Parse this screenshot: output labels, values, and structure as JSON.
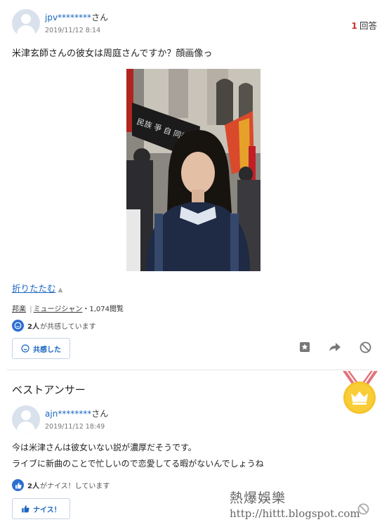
{
  "question": {
    "user": "jpv********",
    "honorific": "さん",
    "date": "2019/11/12 8:14",
    "answer_count": "1",
    "answer_count_label": "回答",
    "text": "米津玄師さんの彼女は周庭さんですか？顔画像っ",
    "collapse_label": "折りたたむ",
    "category_1": "邦楽",
    "category_sep": "|",
    "category_2": "ミュージシャン",
    "views": "・1,074閲覧",
    "empathy_count": "2人",
    "empathy_text": "が共感しています",
    "empathy_button": "共感した"
  },
  "best_answer": {
    "section_title": "ベストアンサー",
    "user": "ajn********",
    "honorific": "さん",
    "date": "2019/11/12 18:49",
    "text_line_1": "今は米津さんは彼女いない説が濃厚だそうです。",
    "text_line_2": "ライブに新曲のことで忙しいので恋愛してる暇がないんでしょうね",
    "nice_count": "2人",
    "nice_text": "がナイス！しています",
    "nice_button": "ナイス！"
  },
  "watermark": {
    "line_1": "熱爆娛樂",
    "line_2": "http://hittt.blogspot.com"
  },
  "colors": {
    "link": "#1a66c2",
    "count_red": "#c8382b",
    "medal_gold": "#f6c42a",
    "ribbon": "#e3737a"
  },
  "icons": [
    "user-avatar-icon",
    "empathy-icon",
    "bookmark-icon",
    "share-icon",
    "block-icon",
    "medal-icon",
    "thumbs-up-icon"
  ]
}
